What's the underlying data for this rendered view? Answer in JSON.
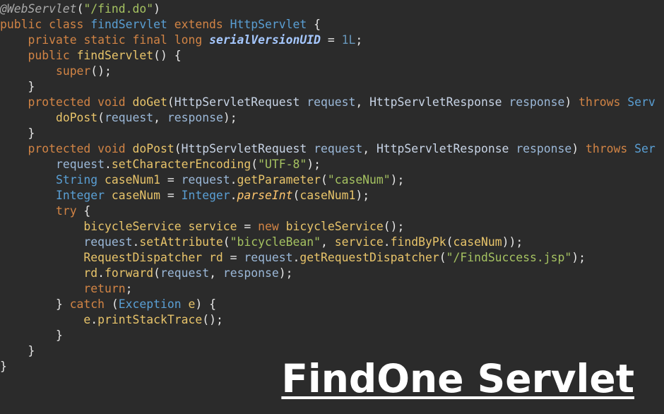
{
  "caption": "FindOne Servlet",
  "colors": {
    "background": "#2b2b2b",
    "keyword": "#d28445",
    "type": "#5a9fd4",
    "method": "#e8c46a",
    "variable": "#9bb8d8",
    "string": "#a5c261",
    "caption": "#ffffff"
  },
  "code": {
    "lines": [
      [
        [
          "ann",
          "@WebServlet"
        ],
        [
          "pl",
          "("
        ],
        [
          "str",
          "\"/find.do\""
        ],
        [
          "pl",
          ")"
        ]
      ],
      [
        [
          "kw",
          "public "
        ],
        [
          "kw",
          "class "
        ],
        [
          "ty2",
          "findServlet "
        ],
        [
          "kw",
          "extends "
        ],
        [
          "ty2",
          "HttpServlet"
        ],
        [
          "pl",
          " {"
        ]
      ],
      [
        [
          "pl",
          "    "
        ],
        [
          "kw",
          "private "
        ],
        [
          "kw",
          "static "
        ],
        [
          "kw",
          "final "
        ],
        [
          "kw",
          "long "
        ],
        [
          "fi",
          "serialVersionUID"
        ],
        [
          "pl",
          " = "
        ],
        [
          "num",
          "1L"
        ],
        [
          "pl",
          ";"
        ]
      ],
      [
        [
          "pl",
          "    "
        ],
        [
          "kw",
          "public "
        ],
        [
          "fn",
          "findServlet"
        ],
        [
          "pl",
          "() {"
        ]
      ],
      [
        [
          "pl",
          "        "
        ],
        [
          "kw",
          "super"
        ],
        [
          "pl",
          "();"
        ]
      ],
      [
        [
          "pl",
          "    }"
        ]
      ],
      [
        [
          "pl",
          "    "
        ],
        [
          "kw",
          "protected "
        ],
        [
          "kw",
          "void "
        ],
        [
          "fn",
          "doGet"
        ],
        [
          "pl",
          "("
        ],
        [
          "ty",
          "HttpServletRequest "
        ],
        [
          "var",
          "request"
        ],
        [
          "pl",
          ", "
        ],
        [
          "ty",
          "HttpServletResponse "
        ],
        [
          "var",
          "response"
        ],
        [
          "pl",
          ") "
        ],
        [
          "kw",
          "throws "
        ],
        [
          "ty2",
          "Serv"
        ]
      ],
      [
        [
          "pl",
          "        "
        ],
        [
          "fn",
          "doPost"
        ],
        [
          "pl",
          "("
        ],
        [
          "var",
          "request"
        ],
        [
          "pl",
          ", "
        ],
        [
          "var",
          "response"
        ],
        [
          "pl",
          ");"
        ]
      ],
      [
        [
          "pl",
          "    }"
        ]
      ],
      [
        [
          "pl",
          "    "
        ],
        [
          "kw",
          "protected "
        ],
        [
          "kw",
          "void "
        ],
        [
          "fn",
          "doPost"
        ],
        [
          "pl",
          "("
        ],
        [
          "ty",
          "HttpServletRequest "
        ],
        [
          "var",
          "request"
        ],
        [
          "pl",
          ", "
        ],
        [
          "ty",
          "HttpServletResponse "
        ],
        [
          "var",
          "response"
        ],
        [
          "pl",
          ") "
        ],
        [
          "kw",
          "throws "
        ],
        [
          "ty2",
          "Ser"
        ]
      ],
      [
        [
          "pl",
          "        "
        ],
        [
          "var",
          "request"
        ],
        [
          "pl",
          "."
        ],
        [
          "fn",
          "setCharacterEncoding"
        ],
        [
          "pl",
          "("
        ],
        [
          "str",
          "\"UTF-8\""
        ],
        [
          "pl",
          ");"
        ]
      ],
      [
        [
          "pl",
          "        "
        ],
        [
          "ty2",
          "String "
        ],
        [
          "fn",
          "caseNum1"
        ],
        [
          "pl",
          " = "
        ],
        [
          "var",
          "request"
        ],
        [
          "pl",
          "."
        ],
        [
          "fn",
          "getParameter"
        ],
        [
          "pl",
          "("
        ],
        [
          "str",
          "\"caseNum\""
        ],
        [
          "pl",
          ");"
        ]
      ],
      [
        [
          "pl",
          "        "
        ],
        [
          "ty2",
          "Integer "
        ],
        [
          "fn",
          "caseNum"
        ],
        [
          "pl",
          " = "
        ],
        [
          "ty2",
          "Integer"
        ],
        [
          "pl",
          "."
        ],
        [
          "it",
          "parseInt"
        ],
        [
          "pl",
          "("
        ],
        [
          "fn",
          "caseNum1"
        ],
        [
          "pl",
          ");"
        ]
      ],
      [
        [
          "pl",
          "        "
        ],
        [
          "kw",
          "try"
        ],
        [
          "pl",
          " {"
        ]
      ],
      [
        [
          "pl",
          "            "
        ],
        [
          "fn",
          "bicycleService "
        ],
        [
          "fn",
          "service"
        ],
        [
          "pl",
          " = "
        ],
        [
          "kw",
          "new "
        ],
        [
          "fn",
          "bicycleService"
        ],
        [
          "pl",
          "();"
        ]
      ],
      [
        [
          "pl",
          "            "
        ],
        [
          "var",
          "request"
        ],
        [
          "pl",
          "."
        ],
        [
          "fn",
          "setAttribute"
        ],
        [
          "pl",
          "("
        ],
        [
          "str",
          "\"bicycleBean\""
        ],
        [
          "pl",
          ", "
        ],
        [
          "fn",
          "service"
        ],
        [
          "pl",
          "."
        ],
        [
          "fn",
          "findByPk"
        ],
        [
          "pl",
          "("
        ],
        [
          "fn",
          "caseNum"
        ],
        [
          "pl",
          "));"
        ]
      ],
      [
        [
          "pl",
          "            "
        ],
        [
          "fn",
          "RequestDispatcher "
        ],
        [
          "fn",
          "rd"
        ],
        [
          "pl",
          " = "
        ],
        [
          "var",
          "request"
        ],
        [
          "pl",
          "."
        ],
        [
          "fn",
          "getRequestDispatcher"
        ],
        [
          "pl",
          "("
        ],
        [
          "str",
          "\"/FindSuccess.jsp\""
        ],
        [
          "pl",
          ");"
        ]
      ],
      [
        [
          "pl",
          "            "
        ],
        [
          "fn",
          "rd"
        ],
        [
          "pl",
          "."
        ],
        [
          "fn",
          "forward"
        ],
        [
          "pl",
          "("
        ],
        [
          "var",
          "request"
        ],
        [
          "pl",
          ", "
        ],
        [
          "var",
          "response"
        ],
        [
          "pl",
          ");"
        ]
      ],
      [
        [
          "pl",
          "            "
        ],
        [
          "kw",
          "return"
        ],
        [
          "pl",
          ";"
        ]
      ],
      [
        [
          "pl",
          "        } "
        ],
        [
          "kw",
          "catch "
        ],
        [
          "pl",
          "("
        ],
        [
          "ty2",
          "Exception "
        ],
        [
          "fn",
          "e"
        ],
        [
          "pl",
          ") {"
        ]
      ],
      [
        [
          "pl",
          "            "
        ],
        [
          "fn",
          "e"
        ],
        [
          "pl",
          "."
        ],
        [
          "fn",
          "printStackTrace"
        ],
        [
          "pl",
          "();"
        ]
      ],
      [
        [
          "pl",
          "        }"
        ]
      ],
      [
        [
          "pl",
          "    }"
        ]
      ],
      [
        [
          "pl",
          "}"
        ]
      ]
    ]
  }
}
